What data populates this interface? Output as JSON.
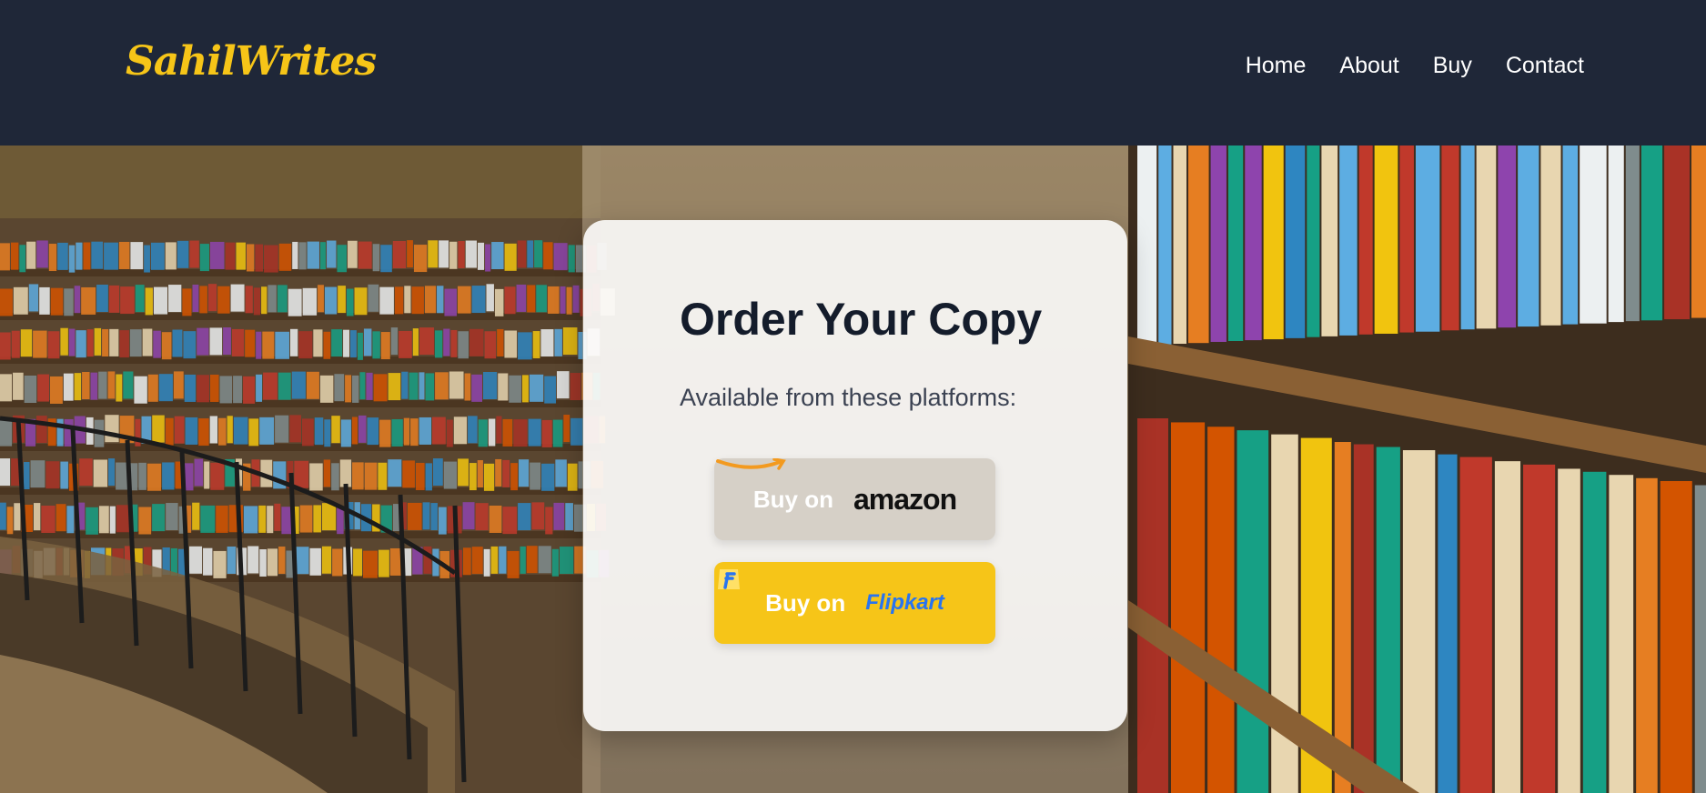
{
  "brand": {
    "name": "SahilWrites",
    "color": "#f6c518"
  },
  "nav": {
    "links": [
      {
        "label": "Home"
      },
      {
        "label": "About"
      },
      {
        "label": "Buy"
      },
      {
        "label": "Contact"
      }
    ]
  },
  "card": {
    "title": "Order Your Copy",
    "subtitle": "Available from these platforms:",
    "buttons": {
      "amazon": {
        "prefix": "Buy on",
        "platform": "amazon",
        "icon": "amazon-smile-logo"
      },
      "flipkart": {
        "prefix": "Buy on",
        "platform": "Flipkart",
        "icon": "flipkart-bag-logo"
      }
    }
  },
  "colors": {
    "nav_bg": "#1f2738",
    "accent": "#f6c518",
    "amazon_button": "#d6d0c7",
    "flipkart_blue": "#2874f0"
  }
}
